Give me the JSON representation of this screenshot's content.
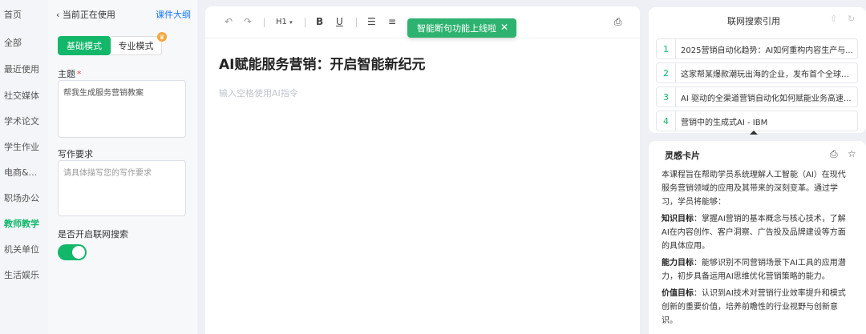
{
  "nav": {
    "items": [
      "首页",
      "全部",
      "最近使用",
      "社交媒体",
      "学术论文",
      "学生作业",
      "电商&...",
      "职场办公",
      "教师教学",
      "机关单位",
      "生活娱乐"
    ],
    "active": "教师教学"
  },
  "form": {
    "back_label": "当前正在使用",
    "outline_link": "课件大纲",
    "mode_basic": "基础模式",
    "mode_pro": "专业模式",
    "topic_label": "主题",
    "topic_required": "*",
    "topic_value": "帮我生成服务营销教案",
    "req_label": "写作要求",
    "req_placeholder": "请具体描写您的写作要求",
    "search_label": "是否开启联网搜索",
    "search_enabled": true
  },
  "editor": {
    "toolbar": {
      "undo_icon": "undo-icon",
      "redo_icon": "redo-icon",
      "heading": "H1",
      "bold": "B",
      "underline": "U",
      "ordered_list_icon": "ordered-list-icon",
      "bullet_list_icon": "bullet-list-icon",
      "print_icon": "print-icon"
    },
    "title": "AI赋能服务营销：开启智能新纪元",
    "placeholder": "输入空格使用AI指令",
    "toast": "智能断句功能上线啦"
  },
  "refs": {
    "title": "联网搜索引用",
    "items": [
      {
        "num": "1",
        "text": "2025营销自动化趋势：AI如何重构内容生产与..."
      },
      {
        "num": "2",
        "text": "这家帮某爆款潮玩出海的企业，发布首个全球营..."
      },
      {
        "num": "3",
        "text": "AI 驱动的全渠道营销自动化如何赋能业务高速..."
      },
      {
        "num": "4",
        "text": "营销中的生成式AI - IBM"
      }
    ]
  },
  "card": {
    "title": "灵感卡片",
    "intro": "本课程旨在帮助学员系统理解人工智能（AI）在现代服务营销领域的应用及其带来的深刻变革。通过学习，学员将能够：",
    "goal1_label": "知识目标",
    "goal1_text": "：掌握AI营销的基本概念与核心技术，了解AI在内容创作、客户洞察、广告投及品牌建设等方面的具体应用。",
    "goal2_label": "能力目标",
    "goal2_text": "：能够识别不同营销场景下AI工具的应用潜力，初步具备运用AI思维优化营销策略的能力。",
    "goal3_label": "价值目标",
    "goal3_text": "：认识到AI技术对营销行业效率提升和模式创新的重要价值，培养前瞻性的行业视野与创新意识。"
  },
  "colors": {
    "accent": "#12b76a",
    "link": "#1677ff"
  }
}
